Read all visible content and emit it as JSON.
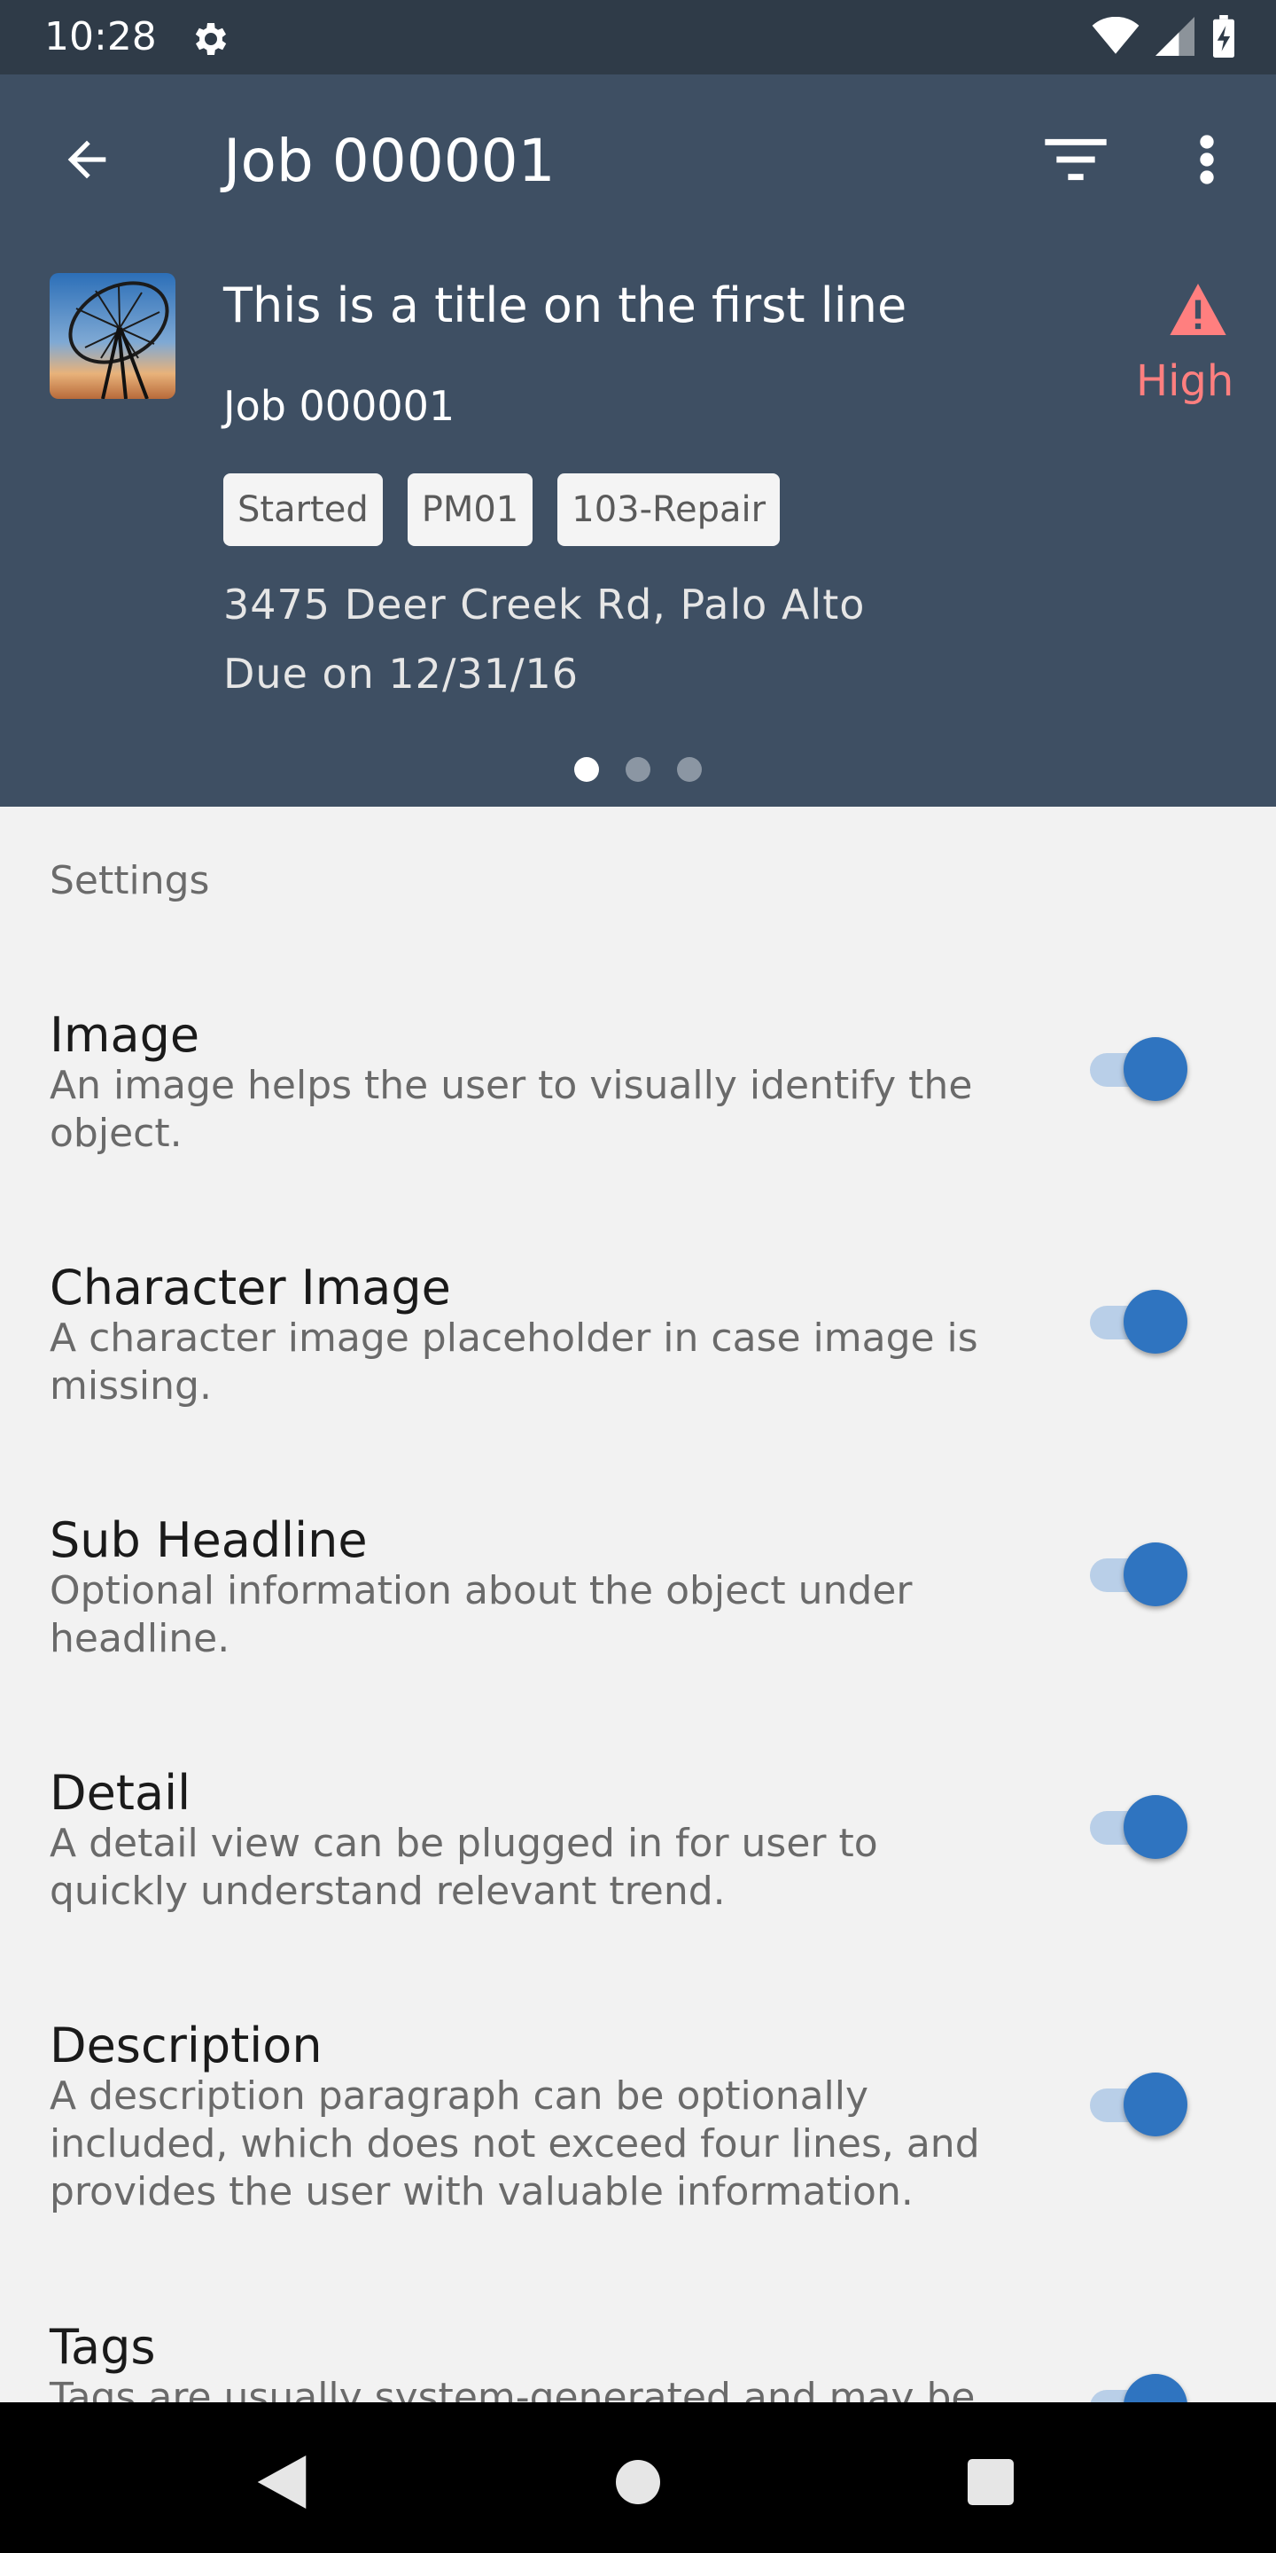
{
  "status_bar": {
    "time": "10:28"
  },
  "header": {
    "title": "Job 000001",
    "object": {
      "title": "This is a title on the first line",
      "subtitle": "Job 000001",
      "tags": [
        "Started",
        "PM01",
        "103-Repair"
      ],
      "address": "3475 Deer Creek Rd, Palo Alto",
      "due": "Due on 12/31/16",
      "priority": "High"
    },
    "page_count": 3,
    "active_page": 1
  },
  "settings": {
    "label": "Settings",
    "items": [
      {
        "title": "Image",
        "description": "An image helps the user to visually identify the object.",
        "enabled": true
      },
      {
        "title": "Character Image",
        "description": "A character image placeholder in case image is missing.",
        "enabled": true
      },
      {
        "title": "Sub Headline",
        "description": "Optional information about the object under headline.",
        "enabled": true
      },
      {
        "title": "Detail",
        "description": "A detail view can be plugged in for user to quickly understand relevant trend.",
        "enabled": true
      },
      {
        "title": "Description",
        "description": "A description paragraph can be optionally included, which does not exceed four lines, and provides the user with valuable information.",
        "enabled": true
      },
      {
        "title": "Tags",
        "description": "Tags are usually system-generated and may be",
        "enabled": true
      }
    ]
  },
  "colors": {
    "status_bar": "#2f3b48",
    "header": "#3e4f63",
    "accent": "#2f74c0",
    "priority": "#ff7f7f"
  }
}
